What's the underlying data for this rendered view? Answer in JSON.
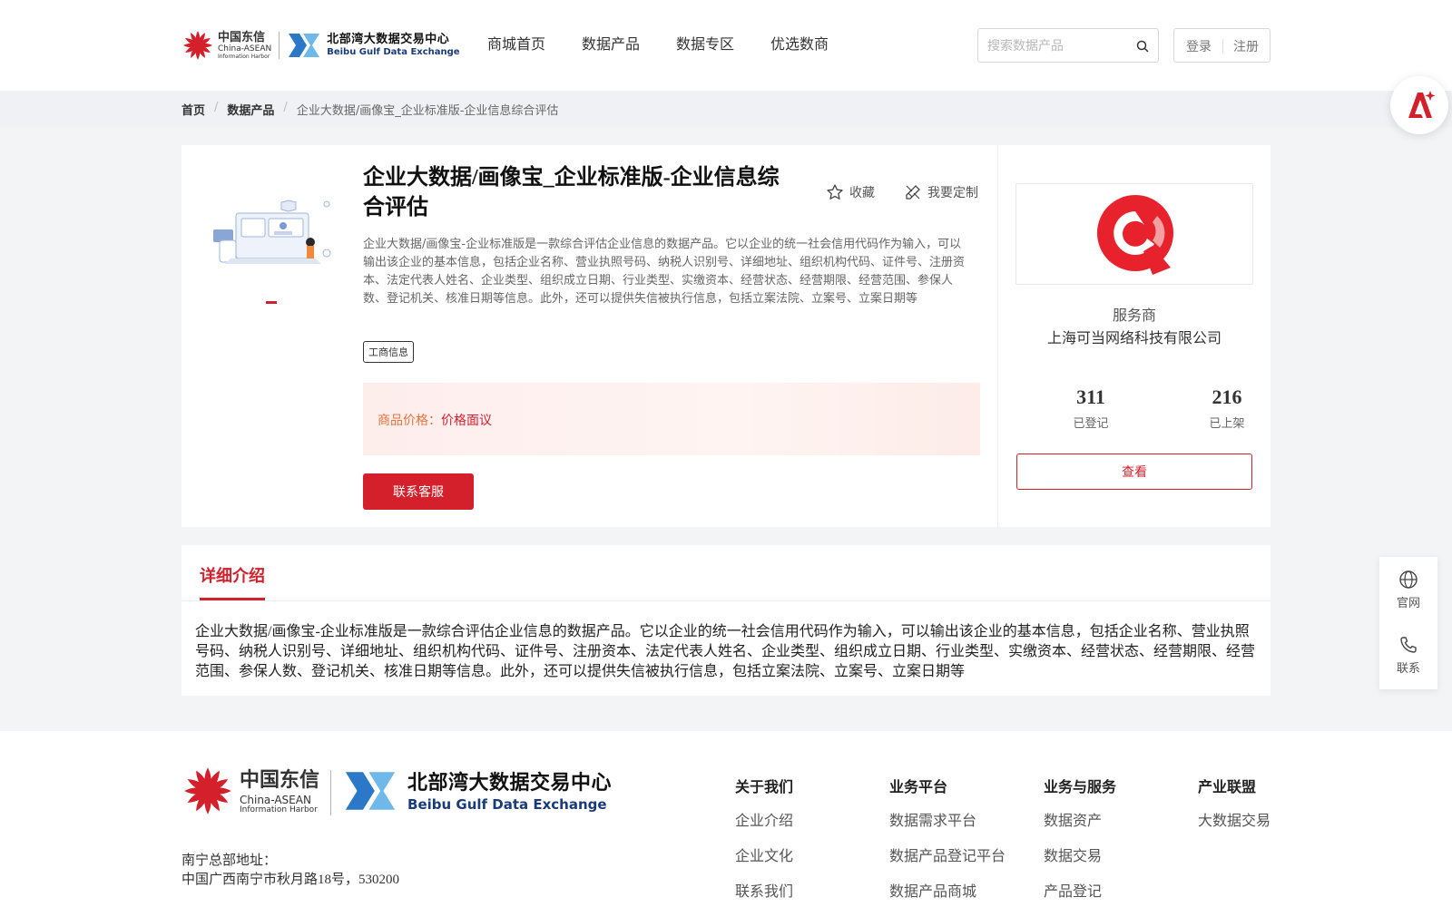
{
  "header": {
    "logo_cn": "中国东信",
    "logo_en1": "China-ASEAN",
    "logo_en2": "Information Harbor",
    "exchange_cn": "北部湾大数据交易中心",
    "exchange_en": "Beibu Gulf Data Exchange",
    "nav": [
      "商城首页",
      "数据产品",
      "数据专区",
      "优选数商"
    ],
    "search_placeholder": "搜索数据产品",
    "login": "登录",
    "register": "注册"
  },
  "breadcrumb": [
    "首页",
    "数据产品",
    "企业大数据/画像宝_企业标准版-企业信息综合评估"
  ],
  "product": {
    "title": "企业大数据/画像宝_企业标准版-企业信息综合评估",
    "favorite": "收藏",
    "customize": "我要定制",
    "description": "企业大数据/画像宝-企业标准版是一款综合评估企业信息的数据产品。它以企业的统一社会信用代码作为输入，可以输出该企业的基本信息，包括企业名称、营业执照号码、纳税人识别号、详细地址、组织机构代码、证件号、注册资本、法定代表人姓名、企业类型、组织成立日期、行业类型、实缴资本、经营状态、经营期限、经营范围、参保人数、登记机关、核准日期等信息。此外，还可以提供失信被执行信息，包括立案法院、立案号、立案日期等",
    "tag": "工商信息",
    "price_label": "商品价格：",
    "price_value": "价格面议",
    "contact_button": "联系客服"
  },
  "provider": {
    "label": "服务商",
    "name": "上海可当网络科技有限公司",
    "stats": [
      {
        "value": "311",
        "label": "已登记"
      },
      {
        "value": "216",
        "label": "已上架"
      }
    ],
    "view_button": "查看"
  },
  "detail": {
    "tab": "详细介绍",
    "text": "企业大数据/画像宝-企业标准版是一款综合评估企业信息的数据产品。它以企业的统一社会信用代码作为输入，可以输出该企业的基本信息，包括企业名称、营业执照号码、纳税人识别号、详细地址、组织机构代码、证件号、注册资本、法定代表人姓名、企业类型、组织成立日期、行业类型、实缴资本、经营状态、经营期限、经营范围、参保人数、登记机关、核准日期等信息。此外，还可以提供失信被执行信息，包括立案法院、立案号、立案日期等"
  },
  "side": {
    "website": "官网",
    "contact": "联系"
  },
  "footer": {
    "addr_label": "南宁总部地址：",
    "addr": "中国广西南宁市秋月路18号，530200",
    "columns": [
      {
        "title": "关于我们",
        "items": [
          "企业介绍",
          "企业文化",
          "联系我们"
        ]
      },
      {
        "title": "业务平台",
        "items": [
          "数据需求平台",
          "数据产品登记平台",
          "数据产品商城"
        ]
      },
      {
        "title": "业务与服务",
        "items": [
          "数据资产",
          "数据交易",
          "产品登记"
        ]
      },
      {
        "title": "产业联盟",
        "items": [
          "大数据交易"
        ]
      }
    ]
  },
  "colors": {
    "accent": "#d4202b",
    "price": "#e6733a",
    "brand_blue": "#1f7bd6"
  }
}
